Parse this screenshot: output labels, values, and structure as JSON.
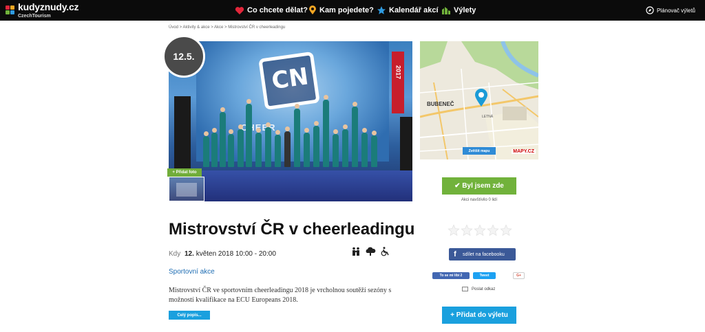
{
  "header": {
    "logo_text": "kudyznudy.cz",
    "logo_sub": "CzechTourism",
    "nav": [
      {
        "label": "Co chcete dělat?",
        "icon": "heart-icon",
        "color": "#e2263a"
      },
      {
        "label": "Kam pojedete?",
        "icon": "map-pin-icon",
        "color": "#f5a623"
      },
      {
        "label": "Kalendář akcí",
        "icon": "star-icon",
        "color": "#2f9be0"
      },
      {
        "label": "Výlety",
        "icon": "trip-icon",
        "color": "#71b23b"
      }
    ],
    "planner_label": "Plánovač výletů",
    "planner_icon": "compass-icon"
  },
  "breadcrumb": "Úvod > Aktivity & akce > Akce > Mistrovství ČR v cheerleadingu",
  "photo": {
    "date_badge": "12.5.",
    "banner_text": "CN",
    "banner_year": "2017",
    "stage_text": "CHEER",
    "add_photo_label": "+ Přidat foto"
  },
  "map": {
    "label_district": "BUBENEČ",
    "label_area": "LETNÁ",
    "show_map_label": "Zvětšit mapu",
    "brand": "MAPY.CZ"
  },
  "event": {
    "title": "Mistrovství ČR v cheerleadingu",
    "when_label": "Kdy",
    "when_day": "12.",
    "when_rest": "květen 2018 10:00 - 20:00",
    "category": "Sportovní akce",
    "description": "Mistrovství ČR ve sportovním cheerleadingu 2018 je vrcholnou soutěží sezóny s možností kvalifikace na ECU Europeans 2018.",
    "more_label": "Celý popis..."
  },
  "sidebar": {
    "been_label": "✔ Byl jsem zde",
    "visited_text": "Akci navštívilo 0 lidí",
    "rating_stars": 5,
    "rating_value": 0,
    "fb_share_label": "sdílet na facebooku",
    "like_label": "To se mi líbí 2",
    "tweet_label": "Tweet",
    "gplus_label": "G+",
    "send_link_label": "Poslat odkaz",
    "add_trip_label": "+ Přidat do výletu"
  }
}
